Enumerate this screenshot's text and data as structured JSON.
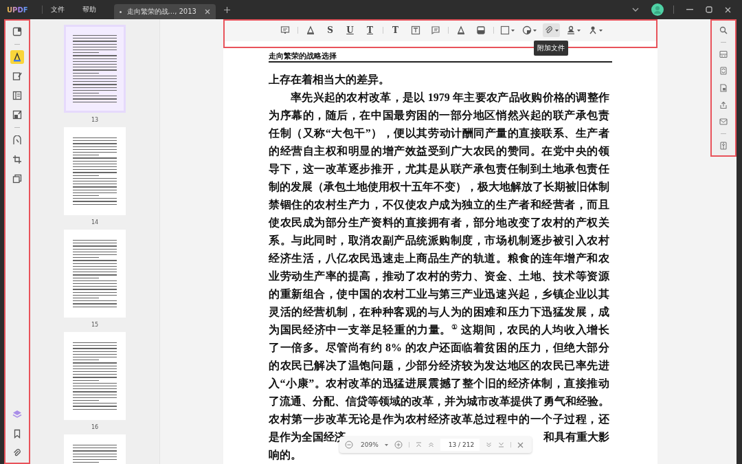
{
  "title_bar": {
    "logo": "UPDF",
    "menus": [
      "文件",
      "帮助"
    ],
    "tabs": [
      {
        "label": "走向繁荣的战..., 2013",
        "selected": true
      }
    ]
  },
  "left_sidebar": {
    "annotation_frame": true,
    "tools": [
      {
        "kind": "reader",
        "selected": false
      },
      {
        "kind": "separator"
      },
      {
        "kind": "comment",
        "selected": true
      },
      {
        "kind": "edit",
        "selected": false
      },
      {
        "kind": "organize",
        "selected": false
      },
      {
        "kind": "convert",
        "selected": false
      },
      {
        "kind": "separator"
      },
      {
        "kind": "forms",
        "selected": false
      },
      {
        "kind": "crop",
        "selected": false
      },
      {
        "kind": "pages",
        "selected": false
      }
    ],
    "bottom_tools": [
      {
        "kind": "layers",
        "selected": false
      },
      {
        "kind": "bookmark",
        "selected": false
      },
      {
        "kind": "attachment",
        "selected": false
      }
    ]
  },
  "thumbnails": [
    {
      "page": "13",
      "selected": true
    },
    {
      "page": "14",
      "selected": false
    },
    {
      "page": "15",
      "selected": false
    },
    {
      "page": "16",
      "selected": false
    },
    {
      "selected": false
    }
  ],
  "toolbar": {
    "annotation_frame": true,
    "tools": [
      {
        "kind": "note",
        "selected": false
      },
      {
        "kind": "separator"
      },
      {
        "kind": "highlight",
        "selected": false
      },
      {
        "kind": "strikeout",
        "glyph": "S",
        "selected": false
      },
      {
        "kind": "underline",
        "glyph": "U",
        "selected": false
      },
      {
        "kind": "squiggly",
        "glyph": "T",
        "selected": false
      },
      {
        "kind": "separator"
      },
      {
        "kind": "text",
        "glyph": "T",
        "selected": false
      },
      {
        "kind": "textbox",
        "selected": false
      },
      {
        "kind": "callout",
        "selected": false
      },
      {
        "kind": "separator"
      },
      {
        "kind": "pencil",
        "selected": false
      },
      {
        "kind": "eraser",
        "selected": false
      },
      {
        "kind": "separator"
      },
      {
        "kind": "shape",
        "dropdown": true,
        "selected": false
      },
      {
        "kind": "sticker",
        "dropdown": true,
        "selected": false
      },
      {
        "kind": "attach",
        "dropdown": true,
        "selected": true,
        "tooltip": "附加文件"
      },
      {
        "kind": "stamp",
        "dropdown": true,
        "selected": false
      },
      {
        "kind": "signature",
        "dropdown": true,
        "selected": false
      }
    ]
  },
  "document": {
    "running_head": "走向繁荣的战略选择",
    "lines": [
      {
        "kind": "end",
        "text": "上存在着相当大的差异。"
      },
      {
        "kind": "start",
        "text": "率先兴起的农村改革，是以 1979 年主要农产品收购价格的调整作"
      },
      {
        "kind": "middle",
        "text": "为序幕的，随后，在中国最穷困的一部分地区悄然兴起的联产承包责"
      },
      {
        "kind": "middle",
        "text": "任制（又称“大包干”），便以其劳动计酬同产量的直接联系、生产者"
      },
      {
        "kind": "middle",
        "text": "的经营自主权和明显的增产效益受到广大农民的赞同。在党中央的领"
      },
      {
        "kind": "middle",
        "text": "导下，这一改革逐步推开，尤其是从联产承包责任制到土地承包责任"
      },
      {
        "kind": "middle",
        "text": "制的发展（承包土地使用权十五年不变），极大地解放了长期被旧体制"
      },
      {
        "kind": "middle",
        "text": "禁锢住的农村生产力，不仅使农户成为独立的生产者和经营者，而且"
      },
      {
        "kind": "middle",
        "text": "使农民成为部分生产资料的直接拥有者，部分地改变了农村的产权关"
      },
      {
        "kind": "middle",
        "text": "系。与此同时，取消农副产品统派购制度，市场机制逐步被引入农村"
      },
      {
        "kind": "middle",
        "text": "经济生活，八亿农民迅速走上商品生产的轨道。粮食的连年增产和农"
      },
      {
        "kind": "middle",
        "text": "业劳动生产率的提高，推动了农村的劳力、资金、土地、技术等资源"
      },
      {
        "kind": "middle",
        "text": "的重新组合，使中国的农村工业与第三产业迅速兴起，乡镇企业以其"
      },
      {
        "kind": "middle",
        "text": "灵活的经营机制，在种种客观的与人为的困难和压力下迅猛发展，成"
      },
      {
        "kind": "middle",
        "text": "为国民经济中一支举足轻重的力量。$^{①}$ 这期间，农民的人均收入增长"
      },
      {
        "kind": "middle",
        "text": "了一倍多。尽管尚有约 8% 的农户还面临着贫困的压力，但绝大部分"
      },
      {
        "kind": "middle",
        "text": "的农民已解决了温饱问题，少部分经济较为发达地区的农民已率先进"
      },
      {
        "kind": "middle",
        "text": "入“小康”。农村改革的迅猛进展震撼了整个旧的经济体制，直接推动"
      },
      {
        "kind": "middle",
        "text": "了流通、分配、信贷等领域的改革，并为城市改革提供了勇气和经验。"
      },
      {
        "kind": "middle",
        "text": "农村第一步改革无论是作为农村经济改革总过程中的一个子过程，还"
      },
      {
        "kind": "split",
        "left": "是作为全国经济",
        "right": "和具有重大影"
      },
      {
        "kind": "end",
        "text": "响的。"
      }
    ]
  },
  "zoom_bar": {
    "zoom": "209%",
    "page_field": "13 / 212"
  },
  "right_sidebar": {
    "annotation_frame": true,
    "tools": [
      {
        "kind": "search"
      },
      {
        "kind": "separator"
      },
      {
        "kind": "ocr"
      },
      {
        "kind": "convert"
      },
      {
        "kind": "protect"
      },
      {
        "kind": "share"
      },
      {
        "kind": "email"
      },
      {
        "kind": "separator"
      },
      {
        "kind": "compress"
      }
    ]
  }
}
